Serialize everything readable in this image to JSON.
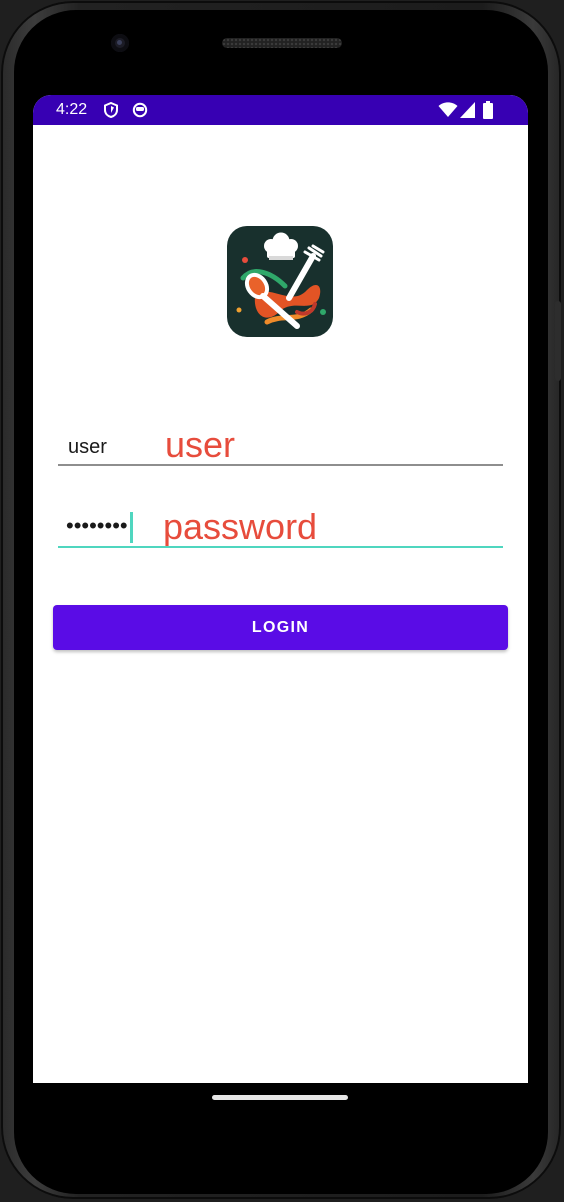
{
  "status_bar": {
    "time": "4:22",
    "left_icons": [
      "shield-icon",
      "robot-face-icon"
    ],
    "right_icons": [
      "wifi-icon",
      "cellular-signal-icon",
      "battery-icon"
    ],
    "background": "#3700b3"
  },
  "app": {
    "logo_icon": "chef-food-logo-icon"
  },
  "form": {
    "username": {
      "value": "user",
      "hint": "user"
    },
    "password": {
      "masked_value": "••••••••",
      "hint": "password"
    },
    "login_label": "LOGIN"
  },
  "colors": {
    "accent": "#5a0ce6",
    "focus": "#4fd6bf",
    "hint": "#e74c3c"
  }
}
